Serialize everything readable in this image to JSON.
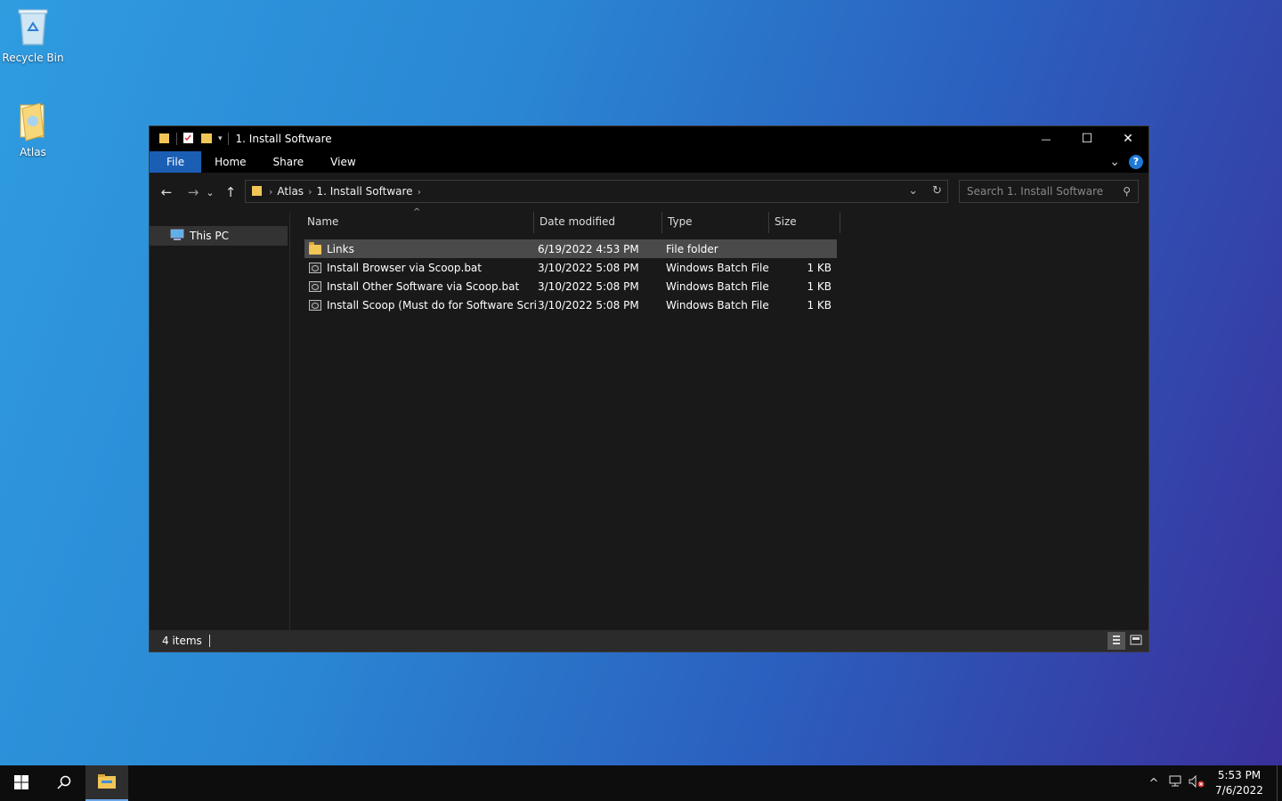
{
  "desktop": {
    "icons": [
      {
        "label": "Recycle Bin",
        "icon": "recycle-bin-icon"
      },
      {
        "label": "Atlas",
        "icon": "folder-icon"
      }
    ]
  },
  "window": {
    "title": "1. Install Software",
    "controls": {
      "minimize": "—",
      "maximize": "☐",
      "close": "✕"
    },
    "ribbon": {
      "tabs": [
        "File",
        "Home",
        "Share",
        "View"
      ],
      "expand": "⌄",
      "help": "?"
    },
    "nav": {
      "back": "←",
      "forward": "→",
      "recent": "⌄",
      "up": "↑"
    },
    "address": {
      "crumbs": [
        "Atlas",
        "1. Install Software"
      ],
      "chevron": "›",
      "dropdown": "⌄",
      "refresh": "↻"
    },
    "search": {
      "placeholder": "Search 1. Install Software",
      "icon": "⚲"
    },
    "navpane": {
      "items": [
        {
          "label": "This PC",
          "icon": "computer-icon"
        }
      ]
    },
    "columns": {
      "name": "Name",
      "date": "Date modified",
      "type": "Type",
      "size": "Size",
      "sort_indicator": "^"
    },
    "files": [
      {
        "name": "Links",
        "date": "6/19/2022 4:53 PM",
        "type": "File folder",
        "size": "",
        "icon": "folder-icon"
      },
      {
        "name": "Install Browser via Scoop.bat",
        "date": "3/10/2022 5:08 PM",
        "type": "Windows Batch File",
        "size": "1 KB",
        "icon": "batch-file-icon"
      },
      {
        "name": "Install Other Software via Scoop.bat",
        "date": "3/10/2022 5:08 PM",
        "type": "Windows Batch File",
        "size": "1 KB",
        "icon": "batch-file-icon"
      },
      {
        "name": "Install Scoop (Must do for Software Scrip...",
        "date": "3/10/2022 5:08 PM",
        "type": "Windows Batch File",
        "size": "1 KB",
        "icon": "batch-file-icon"
      }
    ],
    "status": {
      "items": "4 items"
    }
  },
  "taskbar": {
    "tray": {
      "chevron": "^",
      "time": "5:53 PM",
      "date": "7/6/2022"
    }
  },
  "colors": {
    "accent": "#1a5fb4",
    "folder": "#f1c657",
    "window_bg": "#191919",
    "selection": "#4a4a4a"
  }
}
